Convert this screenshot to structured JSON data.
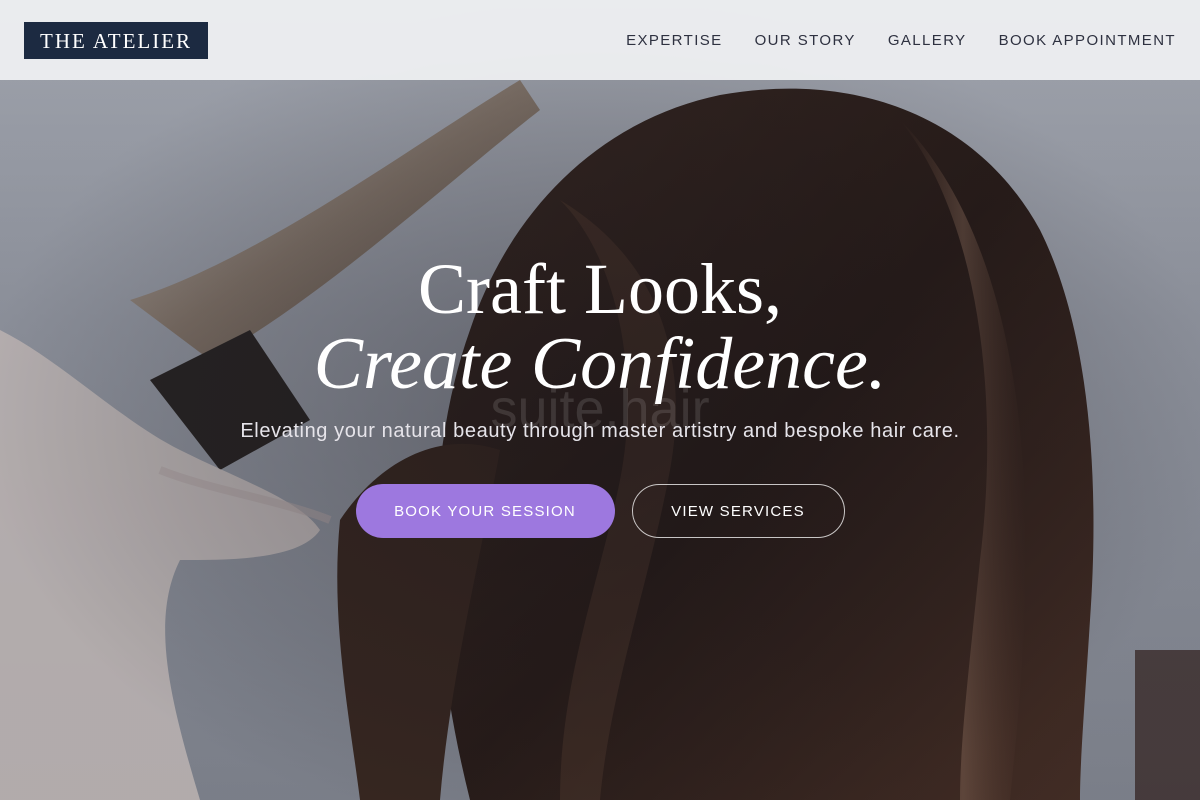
{
  "header": {
    "logo": "THE ATELIER",
    "nav": [
      "EXPERTISE",
      "OUR STORY",
      "GALLERY",
      "BOOK APPOINTMENT"
    ]
  },
  "hero": {
    "headline_line1": "Craft Looks,",
    "headline_line2": "Create Confidence.",
    "watermark": "suite.hair",
    "subtitle": "Elevating your natural beauty through master artistry and bespoke hair care.",
    "primary_cta": "BOOK YOUR SESSION",
    "secondary_cta": "VIEW SERVICES"
  },
  "colors": {
    "logo_bg": "#1c2a41",
    "primary_button": "#9d78df",
    "header_bg": "#f0f1f3"
  }
}
